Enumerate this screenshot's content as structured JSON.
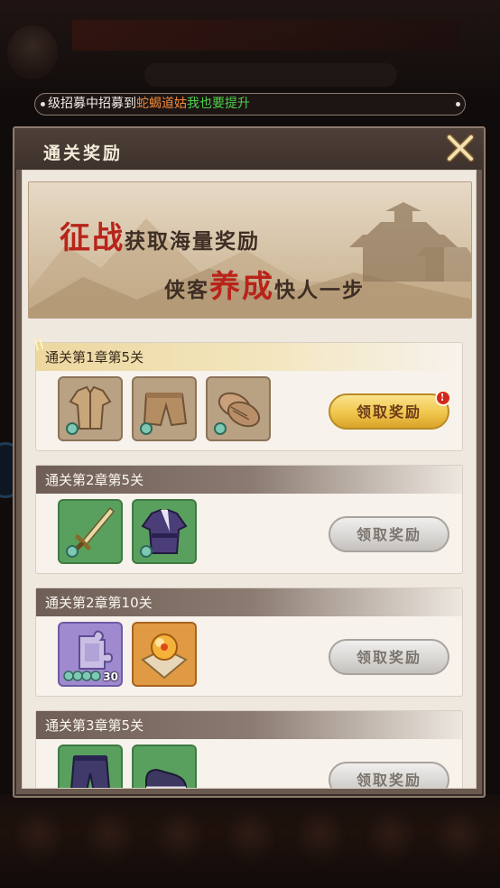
{
  "ticker": {
    "prefix": "级招募中招募到",
    "name": "蛇蝎道姑",
    "action": "我也要提升"
  },
  "dialog": {
    "title": "通关奖励"
  },
  "banner": {
    "line1_red": "征战",
    "line1_rest": "获取海量奖励",
    "line2_a": "侠客",
    "line2_red": "养成",
    "line2_b": "快人一步"
  },
  "rewards": [
    {
      "title": "通关第1章第5关",
      "claim_label": "领取奖励",
      "claimable": true,
      "badge": "!",
      "items": [
        {
          "icon": "tunic-icon",
          "color": "brown"
        },
        {
          "icon": "trousers-icon",
          "color": "brown"
        },
        {
          "icon": "straw-shoes-icon",
          "color": "brown"
        }
      ]
    },
    {
      "title": "通关第2章第5关",
      "claim_label": "领取奖励",
      "claimable": false,
      "items": [
        {
          "icon": "sword-icon",
          "color": "green"
        },
        {
          "icon": "robe-icon",
          "color": "green"
        }
      ]
    },
    {
      "title": "通关第2章第10关",
      "claim_label": "领取奖励",
      "claimable": false,
      "items": [
        {
          "icon": "puzzle-fragment-icon",
          "color": "purple",
          "qty": "30"
        },
        {
          "icon": "golden-orb-icon",
          "color": "orange"
        }
      ]
    },
    {
      "title": "通关第3章第5关",
      "claim_label": "领取奖励",
      "claimable": false,
      "items": [
        {
          "icon": "pants-icon",
          "color": "green"
        },
        {
          "icon": "boots-icon",
          "color": "green"
        }
      ]
    }
  ],
  "colors": {
    "accent_gold": "#f0c64b",
    "ticker_orange": "#f08a3a",
    "ticker_green": "#4fd04a",
    "title_red": "#b8241a"
  }
}
